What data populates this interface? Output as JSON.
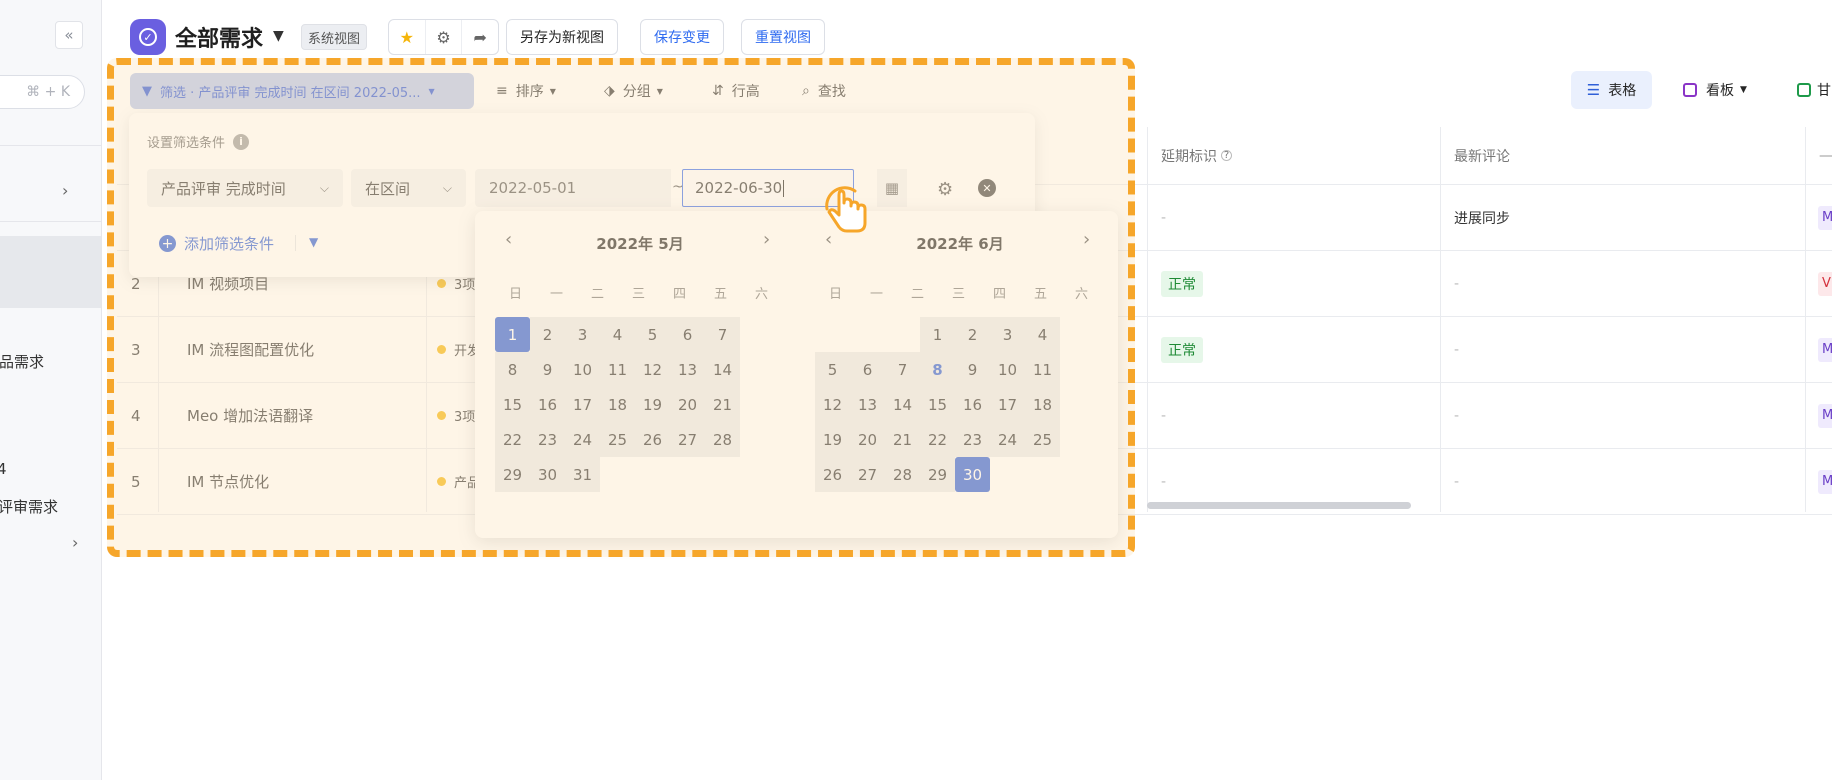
{
  "sidebar": {
    "collapse_glyph": "«",
    "search_shortcut": "⌘ + K",
    "items": [
      "品需求",
      "4",
      "评审需求"
    ]
  },
  "header": {
    "title": "全部需求",
    "badge": "系统视图",
    "save_as": "另存为新视图",
    "save_changes": "保存变更",
    "reset_view": "重置视图"
  },
  "toolbar": {
    "filter_chip": "筛选 · 产品评审 完成时间 在区间 2022-05...",
    "sort": "排序",
    "group": "分组",
    "row_height": "行高",
    "find": "查找"
  },
  "views": {
    "table": "表格",
    "kanban": "看板",
    "gantt": "甘"
  },
  "filter_panel": {
    "title": "设置筛选条件",
    "field": "产品评审 完成时间",
    "operator": "在区间",
    "start_date": "2022-05-01",
    "separator": "~",
    "end_date": "2022-06-30",
    "add_condition": "添加筛选条件"
  },
  "date_picker": {
    "weekdays": [
      "日",
      "一",
      "二",
      "三",
      "四",
      "五",
      "六"
    ],
    "left_month": {
      "title": "2022年 5月",
      "first_weekday": 0,
      "days": 31,
      "selected": 1
    },
    "right_month": {
      "title": "2022年 6月",
      "first_weekday": 3,
      "days": 30,
      "selected": 30,
      "today": 8
    }
  },
  "table": {
    "headers": {
      "delay": "延期标识",
      "comment": "最新评论"
    },
    "rows": [
      {
        "num": "",
        "title": "",
        "status": "",
        "delay": "-",
        "comment": "进展同步",
        "tag": "M"
      },
      {
        "num": "2",
        "title": "IM 视频项目",
        "status": "3项",
        "delay": "正常",
        "comment": "-",
        "tag": "V"
      },
      {
        "num": "3",
        "title": "IM 流程图配置优化",
        "status": "开发",
        "delay": "正常",
        "comment": "-",
        "tag": "M"
      },
      {
        "num": "4",
        "title": "Meo 增加法语翻译",
        "status": "3项",
        "delay": "-",
        "comment": "-",
        "tag": "M"
      },
      {
        "num": "5",
        "title": "IM 节点优化",
        "status": "产品",
        "delay": "-",
        "comment": "-",
        "tag": "M"
      }
    ]
  },
  "colors": {
    "accent": "#2f5fd8",
    "highlight": "#f6a62a",
    "app_icon": "#6a5fe0"
  }
}
